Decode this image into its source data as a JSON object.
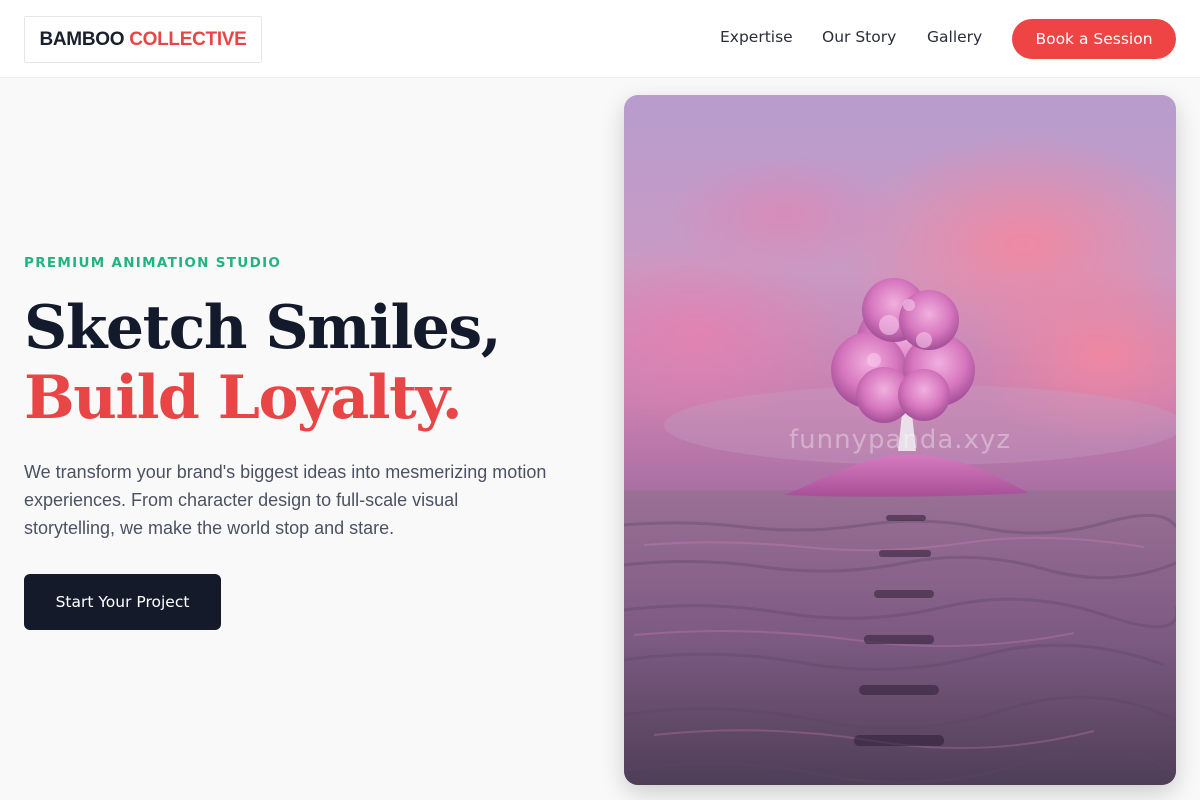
{
  "brand": {
    "word1": "BAMBOO",
    "word2": "COLLECTIVE"
  },
  "nav": {
    "items": [
      "Expertise",
      "Our Story",
      "Gallery"
    ],
    "cta_label": "Book a Session"
  },
  "hero": {
    "eyebrow": "PREMIUM ANIMATION STUDIO",
    "headline_line1": "Sketch Smiles,",
    "headline_line2": "Build Loyalty.",
    "description": "We transform your brand's biggest ideas into mesmerizing motion experiences. From character design to full-scale visual storytelling, we make the world stop and stare.",
    "cta_label": "Start Your Project",
    "image_watermark": "funnypanda.xyz"
  },
  "colors": {
    "accent": "#ef4444",
    "headline_red": "#e84646",
    "eyebrow_green": "#22b380",
    "dark": "#141a2a"
  }
}
